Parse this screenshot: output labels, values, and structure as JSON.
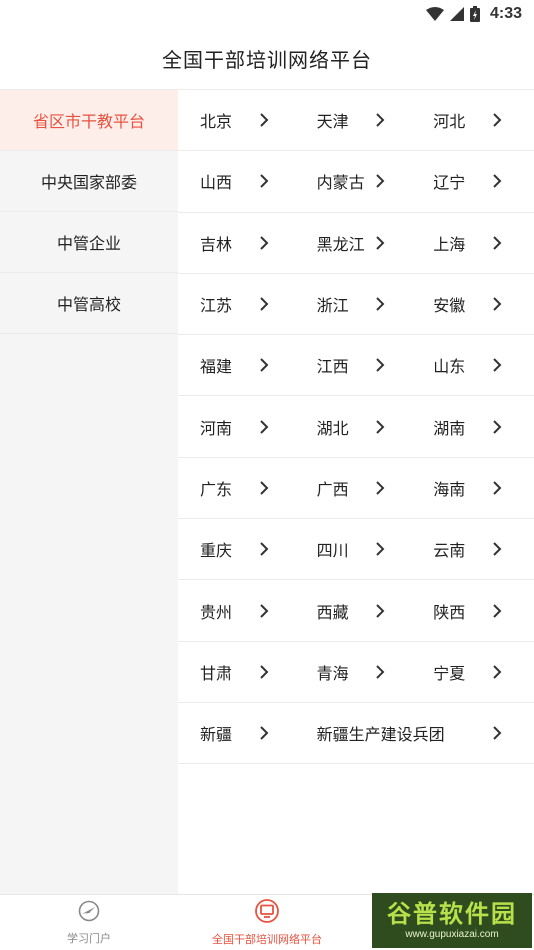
{
  "status_bar": {
    "time": "4:33"
  },
  "header": {
    "title": "全国干部培训网络平台"
  },
  "sidebar": {
    "items": [
      {
        "label": "省区市干教平台",
        "active": true
      },
      {
        "label": "中央国家部委",
        "active": false
      },
      {
        "label": "中管企业",
        "active": false
      },
      {
        "label": "中管高校",
        "active": false
      }
    ]
  },
  "regions": [
    [
      "北京",
      "天津",
      "河北"
    ],
    [
      "山西",
      "内蒙古",
      "辽宁"
    ],
    [
      "吉林",
      "黑龙江",
      "上海"
    ],
    [
      "江苏",
      "浙江",
      "安徽"
    ],
    [
      "福建",
      "江西",
      "山东"
    ],
    [
      "河南",
      "湖北",
      "湖南"
    ],
    [
      "广东",
      "广西",
      "海南"
    ],
    [
      "重庆",
      "四川",
      "云南"
    ],
    [
      "贵州",
      "西藏",
      "陕西"
    ],
    [
      "甘肃",
      "青海",
      "宁夏"
    ],
    [
      "新疆",
      "新疆生产建设兵团"
    ]
  ],
  "bottom_nav": {
    "items": [
      {
        "label": "学习门户",
        "icon": "compass-icon"
      },
      {
        "label": "全国干部培训网络平台",
        "icon": "monitor-icon"
      }
    ]
  },
  "watermark": {
    "title": "谷普软件园",
    "url": "www.gupuxiazai.com"
  },
  "colors": {
    "accent": "#e8523f",
    "active_bg": "#fdeeea",
    "sidebar_bg": "#f5f5f5"
  }
}
